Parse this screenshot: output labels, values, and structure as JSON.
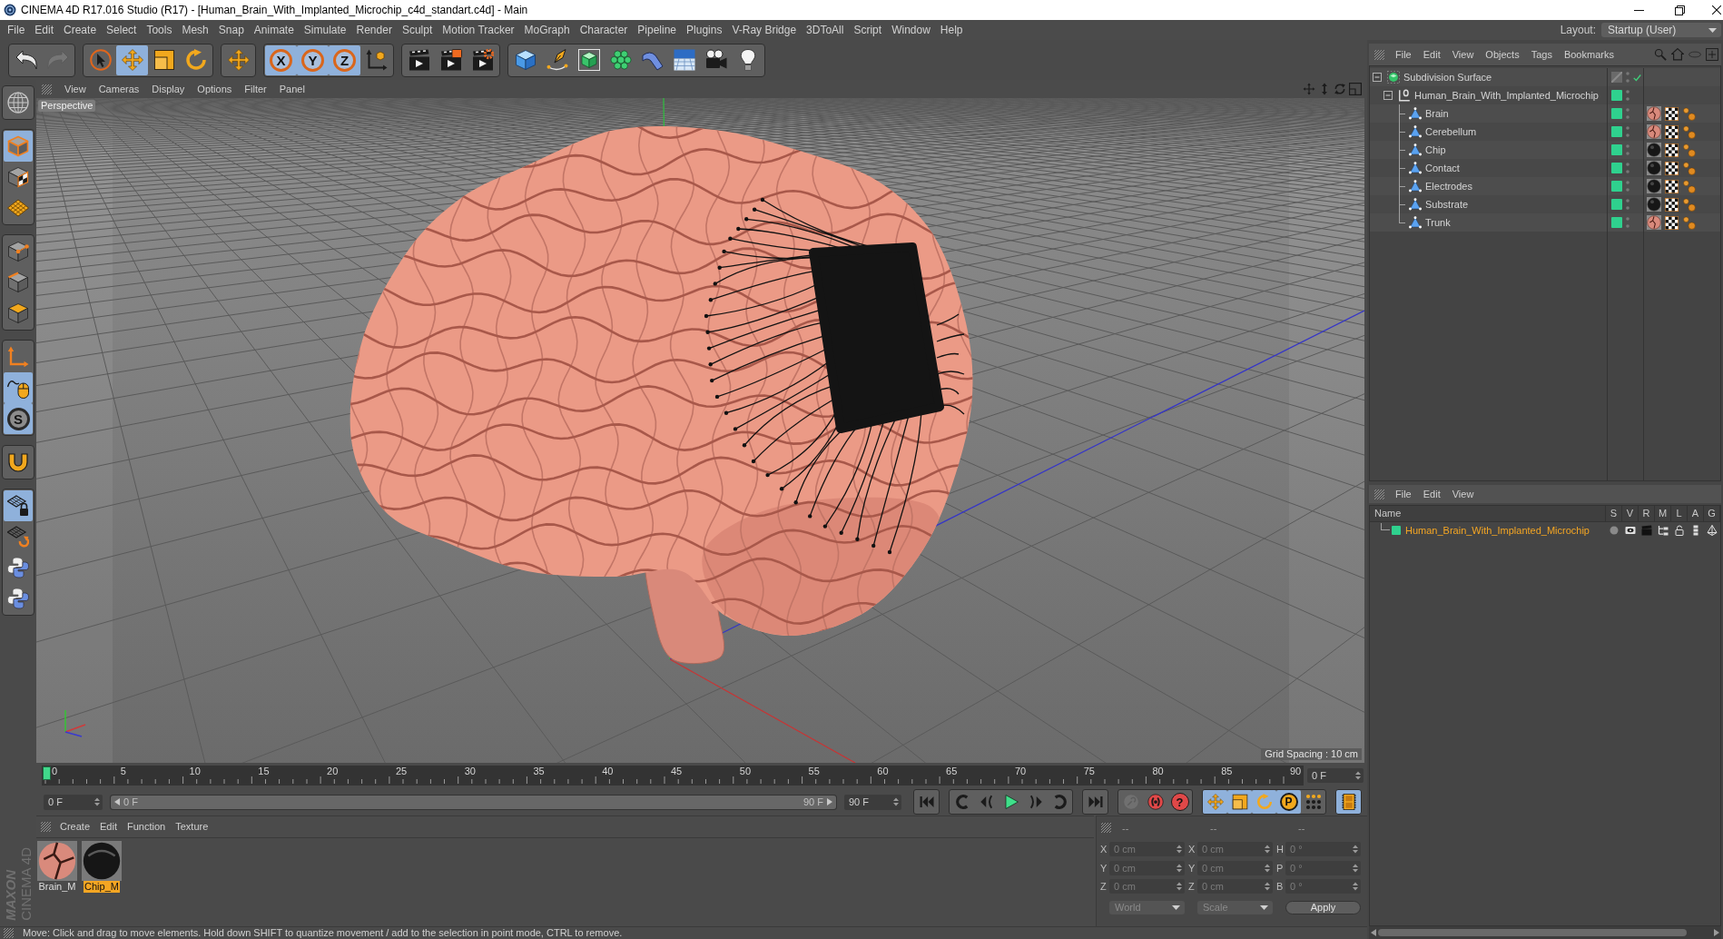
{
  "window": {
    "title": "CINEMA 4D R17.016 Studio (R17) - [Human_Brain_With_Implanted_Microchip_c4d_standart.c4d] - Main"
  },
  "menu_bar": {
    "items": [
      "File",
      "Edit",
      "Create",
      "Select",
      "Tools",
      "Mesh",
      "Snap",
      "Animate",
      "Simulate",
      "Render",
      "Sculpt",
      "Motion Tracker",
      "MoGraph",
      "Character",
      "Pipeline",
      "Plugins",
      "V-Ray Bridge",
      "3DToAll",
      "Script",
      "Window",
      "Help"
    ],
    "layout_label": "Layout:",
    "layout_value": "Startup (User)"
  },
  "toolbar": [
    [
      {
        "kind": "undo",
        "selected": false,
        "disabled": false
      },
      {
        "kind": "redo",
        "selected": false,
        "disabled": true
      }
    ],
    [
      {
        "kind": "live_select",
        "selected": false,
        "disabled": false
      },
      {
        "kind": "move",
        "selected": true,
        "disabled": false
      },
      {
        "kind": "scale",
        "selected": false,
        "disabled": false
      },
      {
        "kind": "rotate",
        "selected": false,
        "disabled": false
      }
    ],
    [
      {
        "kind": "recent_tool",
        "selected": false,
        "disabled": false
      }
    ],
    [
      {
        "kind": "axis_lock",
        "label": "X",
        "selected": true,
        "disabled": false
      },
      {
        "kind": "axis_lock",
        "label": "Y",
        "selected": true,
        "disabled": false
      },
      {
        "kind": "axis_lock",
        "label": "Z",
        "selected": true,
        "disabled": false
      },
      {
        "kind": "coordinate_system",
        "selected": false,
        "disabled": false
      }
    ],
    [
      {
        "kind": "render_view",
        "selected": false,
        "disabled": false
      },
      {
        "kind": "render_picture_viewer",
        "selected": false,
        "disabled": false
      },
      {
        "kind": "render_settings",
        "selected": false,
        "disabled": false
      }
    ],
    [
      {
        "kind": "cube",
        "selected": false,
        "disabled": false
      },
      {
        "kind": "pen",
        "selected": false,
        "disabled": false
      },
      {
        "kind": "subdivision",
        "selected": false,
        "disabled": false
      },
      {
        "kind": "cloner",
        "selected": false,
        "disabled": false
      },
      {
        "kind": "bend",
        "selected": false,
        "disabled": false
      },
      {
        "kind": "floor",
        "selected": false,
        "disabled": false
      },
      {
        "kind": "camera",
        "selected": false,
        "disabled": false
      },
      {
        "kind": "light",
        "selected": false,
        "disabled": false
      }
    ]
  ],
  "mode_toolbar": [
    [
      {
        "kind": "make_editable",
        "selected": false
      }
    ],
    [
      {
        "kind": "model",
        "selected": true
      },
      {
        "kind": "texture",
        "selected": false
      },
      {
        "kind": "workplane",
        "selected": false
      }
    ],
    [
      {
        "kind": "points",
        "selected": false
      },
      {
        "kind": "edges",
        "selected": false
      },
      {
        "kind": "polygons",
        "selected": false
      }
    ],
    [
      {
        "kind": "axis",
        "selected": false
      },
      {
        "kind": "tweak",
        "selected": true
      },
      {
        "kind": "snap",
        "label": "S",
        "selected": true
      }
    ],
    [
      {
        "kind": "magnet",
        "selected": false
      }
    ],
    [
      {
        "kind": "workplane_lock",
        "selected": true
      },
      {
        "kind": "workplane_rotate",
        "selected": false
      },
      {
        "kind": "python",
        "selected": false
      },
      {
        "kind": "python",
        "selected": false
      }
    ]
  ],
  "viewport": {
    "menu": [
      "View",
      "Cameras",
      "Display",
      "Options",
      "Filter",
      "Panel"
    ],
    "camera": "Perspective",
    "grid_spacing": "Grid Spacing : 10 cm"
  },
  "timeline": {
    "ticks": [
      "0",
      "5",
      "10",
      "15",
      "20",
      "25",
      "30",
      "35",
      "40",
      "45",
      "50",
      "55",
      "60",
      "65",
      "70",
      "75",
      "80",
      "85",
      "90"
    ],
    "level": 0,
    "current_frame": "0 F"
  },
  "playback": {
    "current": "0 F",
    "range": {
      "start": "0 F",
      "end": "90 F",
      "level": 1
    },
    "end": "90 F",
    "groups": [
      [
        {
          "kind": "go_start",
          "selected": false,
          "disabled": false
        }
      ],
      [
        {
          "kind": "prev_key",
          "selected": false,
          "disabled": false
        },
        {
          "kind": "prev_frame",
          "selected": false,
          "disabled": false
        },
        {
          "kind": "play",
          "selected": false,
          "disabled": false
        },
        {
          "kind": "next_frame",
          "selected": false,
          "disabled": false
        },
        {
          "kind": "next_key",
          "selected": false,
          "disabled": false
        }
      ],
      [
        {
          "kind": "go_end",
          "selected": false,
          "disabled": false
        }
      ],
      [
        {
          "kind": "record",
          "selected": false,
          "disabled": true
        },
        {
          "kind": "autokey",
          "selected": false,
          "disabled": false
        },
        {
          "kind": "key_help",
          "label": "?",
          "selected": false,
          "disabled": false
        }
      ],
      [
        {
          "kind": "move",
          "selected": true,
          "disabled": false
        },
        {
          "kind": "scale",
          "selected": true,
          "disabled": false
        },
        {
          "kind": "rotate",
          "selected": true,
          "disabled": false
        },
        {
          "kind": "parameter",
          "label": "P",
          "selected": true,
          "disabled": false
        },
        {
          "kind": "point_level",
          "selected": false,
          "disabled": false
        }
      ],
      [
        {
          "kind": "timeline",
          "selected": true,
          "disabled": false
        }
      ]
    ]
  },
  "object_manager": {
    "menu": [
      "File",
      "Edit",
      "View",
      "Objects",
      "Tags",
      "Bookmarks"
    ],
    "tree": [
      {
        "name": "Subdivision Surface",
        "kind": "subdivision",
        "in_layer": false,
        "expanded": true,
        "children": [
          {
            "name": "Human_Brain_With_Implanted_Microchip",
            "kind": "null",
            "in_layer": true,
            "expanded": true,
            "children": [
              {
                "name": "Brain",
                "kind": "polygon",
                "in_layer": true,
                "tags": [
                  {
                    "kind": "brain_material"
                  },
                  {
                    "kind": "uvw"
                  },
                  {
                    "kind": "phong"
                  }
                ]
              },
              {
                "name": "Cerebellum",
                "kind": "polygon",
                "in_layer": true,
                "tags": [
                  {
                    "kind": "brain_material"
                  },
                  {
                    "kind": "uvw"
                  },
                  {
                    "kind": "phong"
                  }
                ]
              },
              {
                "name": "Chip",
                "kind": "polygon",
                "in_layer": true,
                "tags": [
                  {
                    "kind": "chip_material"
                  },
                  {
                    "kind": "uvw"
                  },
                  {
                    "kind": "phong"
                  }
                ]
              },
              {
                "name": "Contact",
                "kind": "polygon",
                "in_layer": true,
                "tags": [
                  {
                    "kind": "chip_material"
                  },
                  {
                    "kind": "uvw"
                  },
                  {
                    "kind": "phong"
                  }
                ]
              },
              {
                "name": "Electrodes",
                "kind": "polygon",
                "in_layer": true,
                "tags": [
                  {
                    "kind": "chip_material"
                  },
                  {
                    "kind": "uvw"
                  },
                  {
                    "kind": "phong"
                  }
                ]
              },
              {
                "name": "Substrate",
                "kind": "polygon",
                "in_layer": true,
                "tags": [
                  {
                    "kind": "chip_material"
                  },
                  {
                    "kind": "uvw"
                  },
                  {
                    "kind": "phong"
                  }
                ]
              },
              {
                "name": "Trunk",
                "kind": "polygon",
                "in_layer": true,
                "tags": [
                  {
                    "kind": "brain_material"
                  },
                  {
                    "kind": "uvw"
                  },
                  {
                    "kind": "phong"
                  }
                ]
              }
            ]
          }
        ]
      }
    ]
  },
  "layer_manager": {
    "menu": [
      "File",
      "Edit",
      "View"
    ],
    "columns": [
      "Name",
      "S",
      "V",
      "R",
      "M",
      "L",
      "A",
      "G"
    ],
    "layers": [
      {
        "name": "Human_Brain_With_Implanted_Microchip",
        "selected": true
      }
    ]
  },
  "material_manager": {
    "menu": [
      "Create",
      "Edit",
      "Function",
      "Texture"
    ],
    "materials": [
      {
        "name": "Brain_M",
        "kind": "brain",
        "selected": false
      },
      {
        "name": "Chip_M",
        "kind": "chip",
        "selected": true
      }
    ]
  },
  "coordinates": {
    "headers": [
      "--",
      "--",
      "--"
    ],
    "rows": [
      [
        {
          "axis": "X",
          "value": "0 cm"
        },
        {
          "axis": "X",
          "value": "0 cm"
        },
        {
          "axis": "H",
          "value": "0 °"
        }
      ],
      [
        {
          "axis": "Y",
          "value": "0 cm"
        },
        {
          "axis": "Y",
          "value": "0 cm"
        },
        {
          "axis": "P",
          "value": "0 °"
        }
      ],
      [
        {
          "axis": "Z",
          "value": "0 cm"
        },
        {
          "axis": "Z",
          "value": "0 cm"
        },
        {
          "axis": "B",
          "value": "0 °"
        }
      ]
    ],
    "dropdowns": [
      "World",
      "Scale"
    ],
    "apply": "Apply"
  },
  "branding": [
    "MAXON",
    "CINEMA 4D"
  ],
  "status_bar": "Move: Click and drag to move elements. Hold down SHIFT to quantize movement / add to the selection in point mode, CTRL to remove."
}
